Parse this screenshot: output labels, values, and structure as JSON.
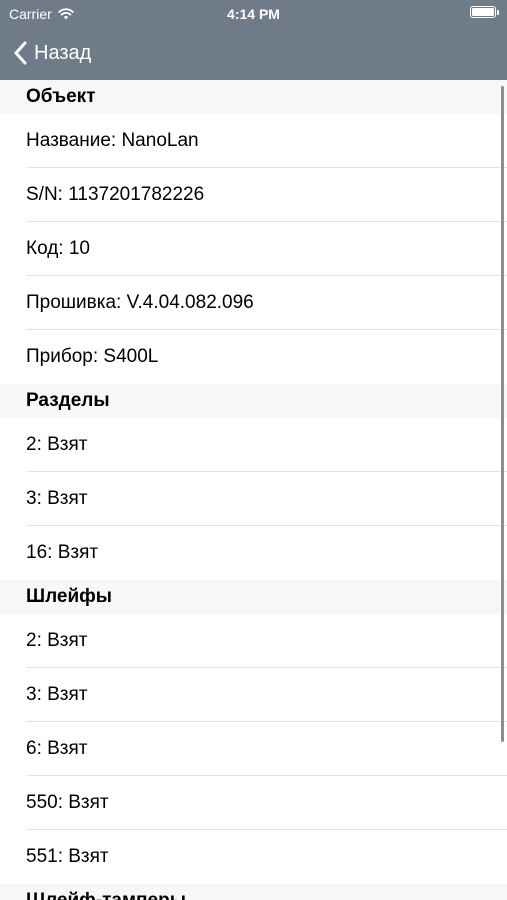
{
  "status_bar": {
    "carrier": "Carrier",
    "time": "4:14 PM",
    "wifi_icon": "wifi-icon",
    "battery_icon": "battery-icon"
  },
  "nav": {
    "back_label": "Назад",
    "back_icon": "chevron-left-icon"
  },
  "colors": {
    "nav_background": "#6f7b88",
    "section_background": "#f7f7f7",
    "separator": "#e3e3e6"
  },
  "sections": [
    {
      "title": "Объект",
      "rows": [
        "Название: NanoLan",
        "S/N: 1137201782226",
        "Код: 10",
        "Прошивка: V.4.04.082.096",
        "Прибор: S400L"
      ]
    },
    {
      "title": "Разделы",
      "rows": [
        "2: Взят",
        "3: Взят",
        "16: Взят"
      ]
    },
    {
      "title": "Шлейфы",
      "rows": [
        "2: Взят",
        "3: Взят",
        "6: Взят",
        "550: Взят",
        "551: Взят"
      ]
    },
    {
      "title": "Шлейф-тамперы",
      "rows": []
    }
  ]
}
